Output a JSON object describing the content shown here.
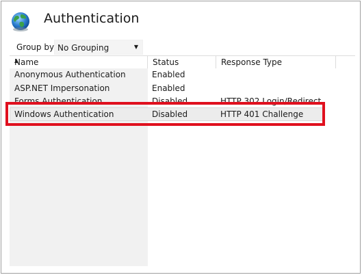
{
  "page": {
    "title": "Authentication"
  },
  "toolbar": {
    "group_by_label": "Group by:",
    "group_by_value": "No Grouping"
  },
  "table": {
    "columns": [
      "Name",
      "Status",
      "Response Type"
    ],
    "rows": [
      {
        "name": "Anonymous Authentication",
        "status": "Enabled",
        "response": ""
      },
      {
        "name": "ASP.NET Impersonation",
        "status": "Enabled",
        "response": ""
      },
      {
        "name": "Forms Authentication",
        "status": "Disabled",
        "response": "HTTP 302 Login/Redirect"
      },
      {
        "name": "Windows Authentication",
        "status": "Disabled",
        "response": "HTTP 401 Challenge"
      }
    ]
  },
  "colors": {
    "highlight": "#e0101e"
  },
  "icons": {
    "page_icon": "globe-icon",
    "sort": "sort-ascending-icon",
    "dropdown": "chevron-down-icon"
  }
}
